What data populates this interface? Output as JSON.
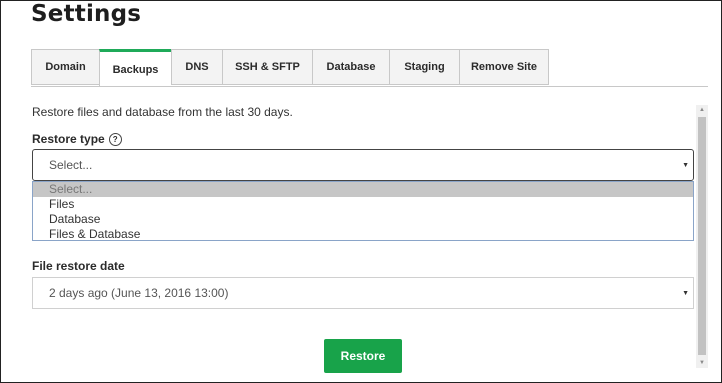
{
  "page": {
    "title": "Settings"
  },
  "tabs": [
    {
      "label": "Domain"
    },
    {
      "label": "Backups"
    },
    {
      "label": "DNS"
    },
    {
      "label": "SSH & SFTP"
    },
    {
      "label": "Database"
    },
    {
      "label": "Staging"
    },
    {
      "label": "Remove Site"
    }
  ],
  "active_tab": "Backups",
  "description": "Restore files and database from the last 30 days.",
  "restore_type": {
    "label": "Restore type",
    "help_glyph": "?",
    "value": "Select...",
    "options": [
      "Select...",
      "Files",
      "Database",
      "Files & Database"
    ],
    "highlighted": "Select..."
  },
  "file_restore_date": {
    "label": "File restore date",
    "value": "2 days ago (June 13, 2016 13:00)"
  },
  "restore_button": {
    "label": "Restore"
  },
  "colors": {
    "accent": "#1faa59",
    "button": "#18a34a"
  }
}
